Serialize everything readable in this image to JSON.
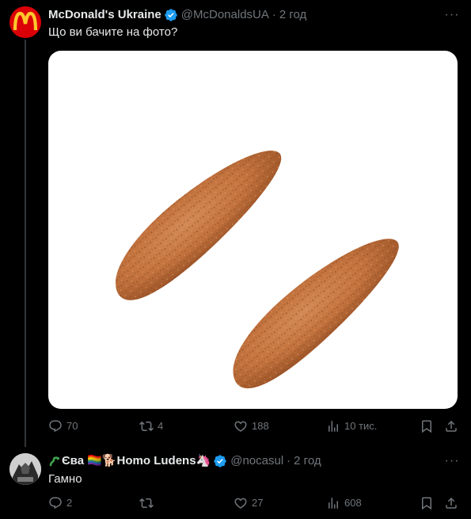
{
  "tweet": {
    "author_name": "McDonald's Ukraine",
    "handle": "@McDonaldsUA",
    "separator": "·",
    "time": "2 год",
    "text": "Що ви бачите на фото?",
    "media_description_icon": "chicken-strips-image",
    "actions": {
      "replies": "70",
      "retweets": "4",
      "likes": "188",
      "views": "10 тис."
    }
  },
  "reply": {
    "author_name": "Єва 🏳️‍🌈🐕Homo Ludens🦄",
    "handle": "@nocasul",
    "separator": "·",
    "time": "2 год",
    "text": "Гамно",
    "actions": {
      "replies": "2",
      "retweets": "",
      "likes": "27",
      "views": "608"
    }
  },
  "colors": {
    "background": "#000000",
    "text": "#e7e9ea",
    "secondary": "#71767b",
    "verified": "#1d9bf0",
    "mcdonalds_red": "#db0007",
    "mcdonalds_yellow": "#ffc72c"
  }
}
